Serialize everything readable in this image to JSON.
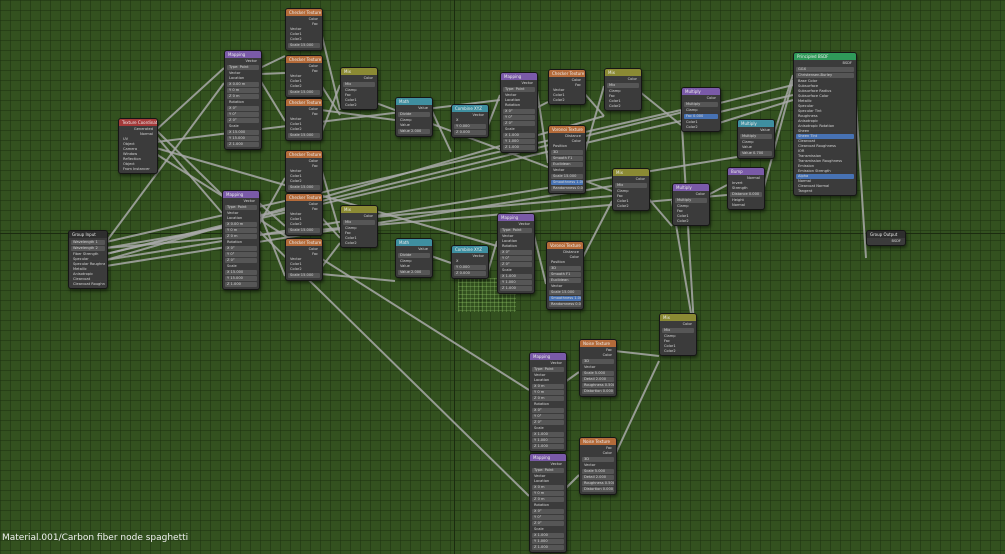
{
  "caption": "Material.001/Carbon fiber node spaghetti",
  "colors": {
    "background": "#33511f",
    "wire": "#a8a8a8",
    "header_mapping": "#7a5aa8",
    "header_texture": "#b46b3a",
    "header_mix": "#8b8a34",
    "header_converter": "#3f8fa0",
    "header_input": "#a53a3a",
    "header_shader": "#2f9a5a"
  },
  "nodes": {
    "group_input": {
      "title": "Group Input",
      "rows": [
        "Wavelength 1",
        "Wavelength 2",
        "Fiber Strength",
        "Specular",
        "Specular Roughness",
        "Metallic",
        "Anisotropic",
        "Clearcoat",
        "Clearcoat Roughness"
      ]
    },
    "texcoord": {
      "title": "Texture Coordinate",
      "rows": [
        "Generated",
        "Normal",
        "UV",
        "Object",
        "Camera",
        "Window",
        "Reflection",
        "Object",
        "From Instancer"
      ]
    },
    "mapping_top": {
      "title": "Mapping",
      "rows": [
        "Vector",
        "Type: Point",
        "Vector",
        "Location",
        "X 0.00 m",
        "Y 0 m",
        "Z 0 m",
        "Rotation",
        "X 0°",
        "Y 0°",
        "Z 0°",
        "Scale",
        "X 15.000",
        "Y 15.000",
        "Z 1.000"
      ]
    },
    "mapping_mid": {
      "title": "Mapping",
      "rows": [
        "Vector",
        "Type: Point",
        "Vector",
        "Location",
        "X 0.00 m",
        "Y 0 m",
        "Z 0 m",
        "Rotation",
        "X 0°",
        "Y 0°",
        "Z 0°",
        "Scale",
        "X 15.000",
        "Y 15.000",
        "Z 1.000"
      ]
    },
    "checker_1": {
      "title": "Checker Texture",
      "rows": [
        "Color",
        "Fac",
        "Vector",
        "Color1",
        "Color2",
        "Scale 15.000"
      ]
    },
    "checker_2": {
      "title": "Checker Texture",
      "rows": [
        "Color",
        "Fac",
        "Vector",
        "Color1",
        "Color2",
        "Scale 15.000"
      ]
    },
    "checker_3": {
      "title": "Checker Texture",
      "rows": [
        "Color",
        "Fac",
        "Vector",
        "Color1",
        "Color2",
        "Scale 15.000"
      ]
    },
    "checker_4": {
      "title": "Checker Texture",
      "rows": [
        "Color",
        "Fac",
        "Vector",
        "Color1",
        "Color2",
        "Scale 15.000"
      ]
    },
    "checker_5": {
      "title": "Checker Texture",
      "rows": [
        "Color",
        "Fac",
        "Vector",
        "Color1",
        "Color2",
        "Scale 15.000"
      ]
    },
    "checker_6": {
      "title": "Checker Texture",
      "rows": [
        "Color",
        "Fac",
        "Vector",
        "Color1",
        "Color2",
        "Scale 15.000"
      ]
    },
    "mix_1": {
      "title": "Mix",
      "rows": [
        "Color",
        "Mix",
        "Clamp",
        "Fac",
        "Color1",
        "Color2"
      ]
    },
    "mix_2": {
      "title": "Mix",
      "rows": [
        "Color",
        "Mix",
        "Clamp",
        "Fac",
        "Color1",
        "Color2"
      ]
    },
    "math_1": {
      "title": "Math",
      "rows": [
        "Value",
        "Divide",
        "Clamp",
        "Value",
        "Value 2.000"
      ]
    },
    "math_2": {
      "title": "Math",
      "rows": [
        "Value",
        "Divide",
        "Clamp",
        "Value",
        "Value 2.000"
      ]
    },
    "combine_1": {
      "title": "Combine XYZ",
      "rows": [
        "Vector",
        "X",
        "Y 0.000",
        "Z 0.000"
      ]
    },
    "combine_2": {
      "title": "Combine XYZ",
      "rows": [
        "Vector",
        "X",
        "Y 0.000",
        "Z 0.000"
      ]
    },
    "mapping_r1": {
      "title": "Mapping",
      "rows": [
        "Vector",
        "Type: Point",
        "Vector",
        "Location",
        "Rotation",
        "X 0°",
        "Y 0°",
        "Z 0°",
        "Scale",
        "X 1.000",
        "Y 1.000",
        "Z 1.000"
      ]
    },
    "mapping_r2": {
      "title": "Mapping",
      "rows": [
        "Vector",
        "Type: Point",
        "Vector",
        "Location",
        "Rotation",
        "X 0°",
        "Y 0°",
        "Z 0°",
        "Scale",
        "X 1.000",
        "Y 1.000",
        "Z 1.000"
      ]
    },
    "checker_r1": {
      "title": "Checker Texture",
      "rows": [
        "Color",
        "Fac",
        "Vector",
        "Color1",
        "Color2"
      ]
    },
    "voronoi_1": {
      "title": "Voronoi Texture",
      "rows": [
        "Distance",
        "Color",
        "Position",
        "3D",
        "Smooth F1",
        "Euclidean",
        "Vector",
        "Scale 15.000",
        "Smoothness 1.000",
        "Randomness 0.000"
      ]
    },
    "voronoi_2": {
      "title": "Voronoi Texture",
      "rows": [
        "Distance",
        "Color",
        "Position",
        "3D",
        "Smooth F1",
        "Euclidean",
        "Vector",
        "Scale 15.000",
        "Smoothness 1.000",
        "Randomness 0.000"
      ]
    },
    "mix_3": {
      "title": "Mix",
      "rows": [
        "Color",
        "Mix",
        "Clamp",
        "Fac",
        "Color1",
        "Color2"
      ]
    },
    "mix_4": {
      "title": "Mix",
      "rows": [
        "Color",
        "Mix",
        "Clamp",
        "Fac",
        "Color1",
        "Color2"
      ]
    },
    "mix_5": {
      "title": "Mix",
      "rows": [
        "Color",
        "Mix",
        "Clamp",
        "Fac",
        "Color1",
        "Color2"
      ]
    },
    "multiply_1": {
      "title": "Multiply",
      "rows": [
        "Color",
        "Multiply",
        "Clamp",
        "Fac 0.000",
        "Color1",
        "Color2"
      ]
    },
    "multiply_2": {
      "title": "Multiply",
      "rows": [
        "Color",
        "Multiply",
        "Clamp",
        "Fac",
        "Color1",
        "Color2"
      ]
    },
    "math_multiply": {
      "title": "Multiply",
      "rows": [
        "Value",
        "Multiply",
        "Clamp",
        "Value",
        "Value 0.700"
      ]
    },
    "bump": {
      "title": "Bump",
      "rows": [
        "Normal",
        "Invert",
        "Strength",
        "Distance 0.000",
        "Height",
        "Normal"
      ]
    },
    "mapping_b1": {
      "title": "Mapping",
      "rows": [
        "Vector",
        "Type: Point",
        "Vector",
        "Location",
        "X 0 m",
        "Y 0 m",
        "Z 0 m",
        "Rotation",
        "X 0°",
        "Y 0°",
        "Z 0°",
        "Scale",
        "X 1.000",
        "Y 1.000",
        "Z 1.000"
      ]
    },
    "mapping_b2": {
      "title": "Mapping",
      "rows": [
        "Vector",
        "Type: Point",
        "Vector",
        "Location",
        "X 0 m",
        "Y 0 m",
        "Z 0 m",
        "Rotation",
        "X 0°",
        "Y 0°",
        "Z 0°",
        "Scale",
        "X 1.000",
        "Y 1.000",
        "Z 1.000"
      ]
    },
    "noise_1": {
      "title": "Noise Texture",
      "rows": [
        "Fac",
        "Color",
        "3D",
        "Vector",
        "Scale 5.000",
        "Detail 2.000",
        "Roughness 0.500",
        "Distortion 0.000"
      ]
    },
    "noise_2": {
      "title": "Noise Texture",
      "rows": [
        "Fac",
        "Color",
        "3D",
        "Vector",
        "Scale 5.000",
        "Detail 2.000",
        "Roughness 0.500",
        "Distortion 0.000"
      ]
    },
    "mix_6": {
      "title": "Mix",
      "rows": [
        "Color",
        "Mix",
        "Clamp",
        "Fac",
        "Color1",
        "Color2"
      ]
    },
    "principled": {
      "title": "Principled BSDF",
      "rows": [
        "BSDF",
        "GGX",
        "Christensen-Burley",
        "Base Color",
        "Subsurface",
        "Subsurface Radius",
        "Subsurface Color",
        "Metallic",
        "Specular",
        "Specular Tint",
        "Roughness",
        "Anisotropic",
        "Anisotropic Rotation",
        "Sheen",
        "Sheen Tint",
        "Clearcoat",
        "Clearcoat Roughness",
        "IOR",
        "Transmission",
        "Transmission Roughness",
        "Emission",
        "Emission Strength",
        "Alpha",
        "Normal",
        "Clearcoat Normal",
        "Tangent"
      ]
    },
    "group_output": {
      "title": "Group Output",
      "rows": [
        "BSDF"
      ]
    }
  }
}
